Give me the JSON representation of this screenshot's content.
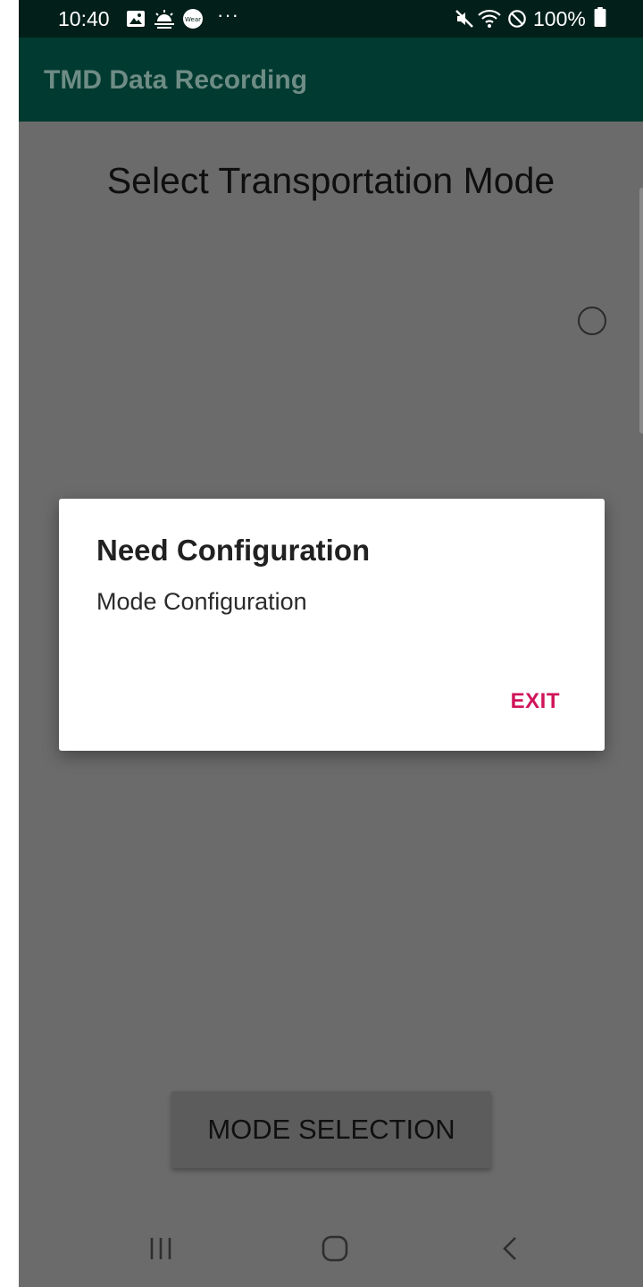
{
  "status_bar": {
    "time": "10:40",
    "battery": "100%",
    "icons": [
      "gallery-icon",
      "weather-icon",
      "wear-icon",
      "more-notifications-icon",
      "mute-icon",
      "wifi-icon",
      "dnd-icon",
      "battery-icon"
    ],
    "wear_label": "Wear",
    "more": "···"
  },
  "app_bar": {
    "title": "TMD Data Recording",
    "color": "#013a30"
  },
  "content": {
    "title": "Select Transportation Mode"
  },
  "dialog": {
    "title": "Need Configuration",
    "message": "Mode Configuration",
    "exit_label": "EXIT",
    "accent": "#d0145a"
  },
  "bottom_button": {
    "label": "MODE SELECTION"
  },
  "nav_bar": {
    "icons": [
      "recent-apps-icon",
      "home-icon",
      "back-icon"
    ]
  }
}
